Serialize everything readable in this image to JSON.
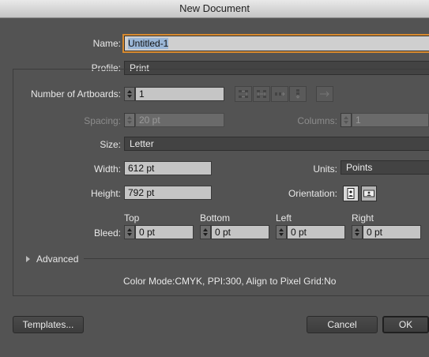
{
  "window": {
    "title": "New Document"
  },
  "name": {
    "label": "Name:",
    "value": "Untitled-1"
  },
  "profile": {
    "label": "Profile:",
    "value": "Print"
  },
  "artboards": {
    "label": "Number of Artboards:",
    "value": "1"
  },
  "spacing": {
    "label": "Spacing:",
    "value": "20 pt"
  },
  "columns": {
    "label": "Columns:",
    "value": "1"
  },
  "size": {
    "label": "Size:",
    "value": "Letter"
  },
  "width": {
    "label": "Width:",
    "value": "612 pt"
  },
  "units": {
    "label": "Units:",
    "value": "Points"
  },
  "height": {
    "label": "Height:",
    "value": "792 pt"
  },
  "orientation": {
    "label": "Orientation:"
  },
  "bleed": {
    "label": "Bleed:",
    "top": {
      "label": "Top",
      "value": "0 pt"
    },
    "bottom": {
      "label": "Bottom",
      "value": "0 pt"
    },
    "left": {
      "label": "Left",
      "value": "0 pt"
    },
    "right": {
      "label": "Right",
      "value": "0 pt"
    }
  },
  "advanced": {
    "label": "Advanced"
  },
  "summary": "Color Mode:CMYK, PPI:300, Align to Pixel Grid:No",
  "buttons": {
    "templates": "Templates...",
    "cancel": "Cancel",
    "ok": "OK"
  },
  "colors": {
    "background": "#535353",
    "focus_ring": "#d78a2f",
    "field": "#c5c5c5"
  }
}
